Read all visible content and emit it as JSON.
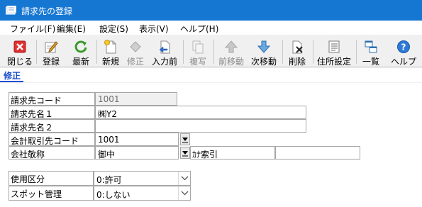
{
  "window": {
    "title": "請求先の登録"
  },
  "menu": [
    {
      "label": "ファイル(F)"
    },
    {
      "label": "編集(E)"
    },
    {
      "label": "設定(S)"
    },
    {
      "label": "表示(V)"
    },
    {
      "label": "ヘルプ(H)"
    }
  ],
  "toolbar": {
    "close": "閉じる",
    "register": "登録",
    "refresh": "最新",
    "new": "新規",
    "modify": "修正",
    "input_prev": "入力前",
    "copy": "複写",
    "prev_move": "前移動",
    "next_move": "次移動",
    "delete": "削除",
    "address_setting": "住所設定",
    "list": "一覧",
    "help": "ヘルプ"
  },
  "mode": {
    "label": "修正"
  },
  "fields": {
    "billing_code": {
      "label": "請求先コード",
      "value": "1001"
    },
    "billing_name1": {
      "label": "請求先名１",
      "value": "㈱Y2"
    },
    "billing_name2": {
      "label": "請求先名２",
      "value": ""
    },
    "account_code": {
      "label": "会計取引先コード",
      "value": "1001"
    },
    "company_title": {
      "label": "会社敬称",
      "value": "御中"
    },
    "kana_search": {
      "label": "ｶﾅ索引",
      "value": ""
    },
    "usage_class": {
      "label": "使用区分",
      "value": "0:許可"
    },
    "spot_manage": {
      "label": "スポット管理",
      "value": "0:しない"
    }
  },
  "colors": {
    "titlebar": "#1677d3",
    "mode_tab": "#1a4ed0"
  }
}
